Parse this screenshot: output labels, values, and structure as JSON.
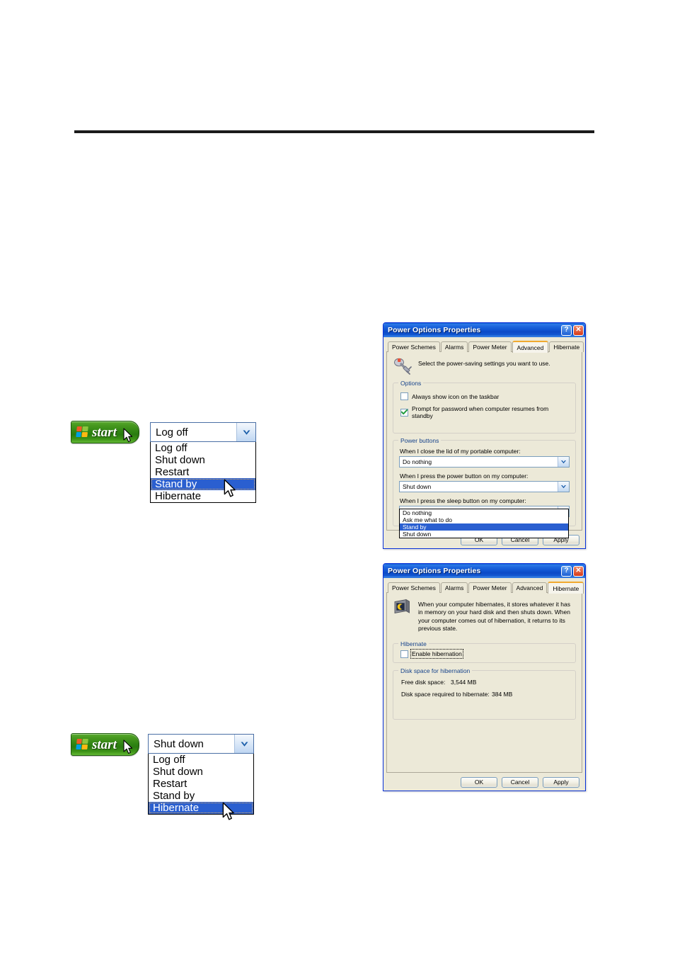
{
  "page": {
    "rule": "horizontal-rule"
  },
  "start_menu_standby": {
    "start_button_label": "start",
    "combo": {
      "value": "Log off",
      "options": [
        "Log off",
        "Shut down",
        "Restart",
        "Stand by",
        "Hibernate"
      ],
      "selected_index": 3
    }
  },
  "start_menu_hibernate": {
    "start_button_label": "start",
    "combo": {
      "value": "Shut down",
      "options": [
        "Log off",
        "Shut down",
        "Restart",
        "Stand by",
        "Hibernate"
      ],
      "selected_index": 4
    }
  },
  "dialog_advanced": {
    "title": "Power Options Properties",
    "help_button": "?",
    "close_button": "✕",
    "tabs": [
      {
        "label": "Power Schemes",
        "active": false
      },
      {
        "label": "Alarms",
        "active": false
      },
      {
        "label": "Power Meter",
        "active": false
      },
      {
        "label": "Advanced",
        "active": true
      },
      {
        "label": "Hibernate",
        "active": false
      }
    ],
    "intro_text": "Select the power-saving settings you want to use.",
    "options_group": {
      "title": "Options",
      "checkbox_taskbar": {
        "label": "Always show icon on the taskbar",
        "checked": false
      },
      "checkbox_password": {
        "label": "Prompt for password when computer resumes from standby",
        "checked": true
      }
    },
    "power_buttons_group": {
      "title": "Power buttons",
      "lid_label": "When I close the lid of my portable computer:",
      "lid_value": "Do nothing",
      "power_label": "When I press the power button on my computer:",
      "power_value": "Shut down",
      "sleep_label": "When I press the sleep button on my computer:",
      "sleep_value": "Stand by",
      "sleep_options": [
        "Do nothing",
        "Ask me what to do",
        "Stand by",
        "Shut down"
      ],
      "sleep_selected_index": 2
    },
    "buttons": {
      "ok": "OK",
      "cancel": "Cancel",
      "apply": "Apply"
    }
  },
  "dialog_hibernate": {
    "title": "Power Options Properties",
    "help_button": "?",
    "close_button": "✕",
    "tabs": [
      {
        "label": "Power Schemes",
        "active": false
      },
      {
        "label": "Alarms",
        "active": false
      },
      {
        "label": "Power Meter",
        "active": false
      },
      {
        "label": "Advanced",
        "active": false
      },
      {
        "label": "Hibernate",
        "active": true
      }
    ],
    "intro_text": "When your computer hibernates, it stores whatever it has in memory on your hard disk and then shuts down. When your computer comes out of hibernation, it returns to its previous state.",
    "hibernate_group": {
      "title": "Hibernate",
      "checkbox_enable": {
        "label": "Enable hibernation",
        "checked": false
      }
    },
    "disk_group": {
      "title": "Disk space for hibernation",
      "free_label": "Free disk space:",
      "free_value": "3,544 MB",
      "required_label": "Disk space required to hibernate:",
      "required_value": "384 MB"
    },
    "buttons": {
      "ok": "OK",
      "cancel": "Cancel",
      "apply": "Apply"
    }
  }
}
